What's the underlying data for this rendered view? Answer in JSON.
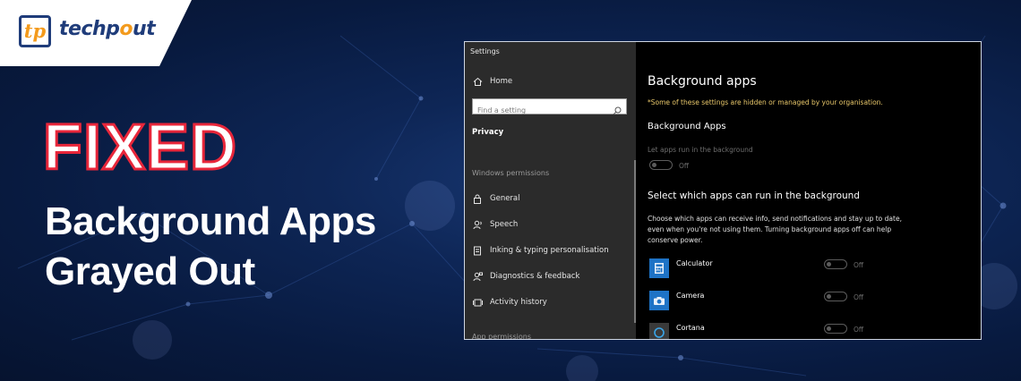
{
  "brand": {
    "logo_mark": "tp",
    "name_part1": "techp",
    "name_o": "o",
    "name_part2": "ut"
  },
  "headline": {
    "fixed": "FIXED",
    "line1": "Background Apps",
    "line2": "Grayed Out"
  },
  "settings": {
    "window_title": "Settings",
    "home_label": "Home",
    "search_placeholder": "Find a setting",
    "privacy_label": "Privacy",
    "windows_permissions_label": "Windows permissions",
    "nav_items": [
      {
        "label": "General",
        "icon": "lock-icon"
      },
      {
        "label": "Speech",
        "icon": "speech-icon"
      },
      {
        "label": "Inking & typing personalisation",
        "icon": "inking-icon"
      },
      {
        "label": "Diagnostics & feedback",
        "icon": "feedback-icon"
      },
      {
        "label": "Activity history",
        "icon": "activity-history-icon"
      }
    ],
    "app_permissions_label": "App permissions",
    "main": {
      "title": "Background apps",
      "warning": "*Some of these settings are hidden or managed by your organisation.",
      "subtitle": "Background Apps",
      "let_apps_label": "Let apps run in the background",
      "main_toggle_state": "Off",
      "select_heading": "Select which apps can run in the background",
      "description": "Choose which apps can receive info, send notifications and stay up to date, even when you're not using them. Turning background apps off can help conserve power.",
      "apps": [
        {
          "name": "Calculator",
          "state": "Off",
          "icon": "calculator-icon",
          "color": "#1e73c6"
        },
        {
          "name": "Camera",
          "state": "Off",
          "icon": "camera-icon",
          "color": "#1e73c6"
        },
        {
          "name": "Cortana",
          "state": "Off",
          "icon": "cortana-icon",
          "color": "#3a3a3a"
        }
      ]
    }
  },
  "colors": {
    "accent_red": "#e8263a",
    "brand_navy": "#1f3c7a",
    "brand_orange": "#f39a1c",
    "warning": "#e8c76a"
  }
}
